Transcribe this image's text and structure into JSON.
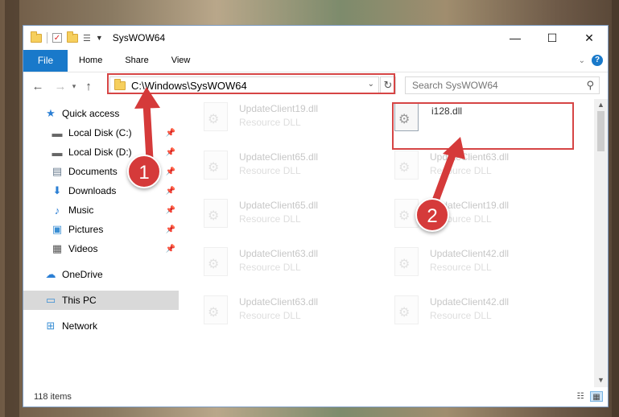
{
  "window": {
    "title": "SysWOW64"
  },
  "ribbon": {
    "tabs": [
      "File",
      "Home",
      "Share",
      "View"
    ]
  },
  "nav": {
    "address": "C:\\Windows\\SysWOW64",
    "search_placeholder": "Search SysWOW64"
  },
  "sidebar": {
    "items": [
      {
        "label": "Quick access",
        "icon": "star-icon"
      },
      {
        "label": "Local Disk (C:)",
        "icon": "drive-icon"
      },
      {
        "label": "Local Disk (D:)",
        "icon": "drive-icon"
      },
      {
        "label": "Documents",
        "icon": "documents-icon"
      },
      {
        "label": "Downloads",
        "icon": "download-icon"
      },
      {
        "label": "Music",
        "icon": "music-icon"
      },
      {
        "label": "Pictures",
        "icon": "pictures-icon"
      },
      {
        "label": "Videos",
        "icon": "videos-icon"
      },
      {
        "label": "OneDrive",
        "icon": "cloud-icon"
      },
      {
        "label": "This PC",
        "icon": "computer-icon"
      },
      {
        "label": "Network",
        "icon": "network-icon"
      }
    ],
    "selected": "This PC"
  },
  "files": {
    "left": [
      {
        "name": "UpdateClient19.dll",
        "type": "Resource DLL"
      },
      {
        "name": "UpdateClient65.dll",
        "type": "Resource DLL"
      },
      {
        "name": "UpdateClient65.dll",
        "type": "Resource DLL"
      },
      {
        "name": "UpdateClient63.dll",
        "type": "Resource DLL"
      },
      {
        "name": "UpdateClient63.dll",
        "type": "Resource DLL"
      }
    ],
    "right": [
      {
        "name": "i128.dll",
        "type": ""
      },
      {
        "name": "UpdateClient63.dll",
        "type": "Resource DLL"
      },
      {
        "name": "UpdateClient19.dll",
        "type": "Resource DLL"
      },
      {
        "name": "UpdateClient42.dll",
        "type": "Resource DLL"
      },
      {
        "name": "UpdateClient42.dll",
        "type": "Resource DLL"
      }
    ]
  },
  "status": {
    "count": "118 items"
  },
  "annotations": {
    "step1": "1",
    "step2": "2",
    "color": "#d53a3a"
  },
  "colors": {
    "accent": "#1979ca",
    "selection": "#d9d9d9",
    "highlight_box": "#d64545"
  }
}
